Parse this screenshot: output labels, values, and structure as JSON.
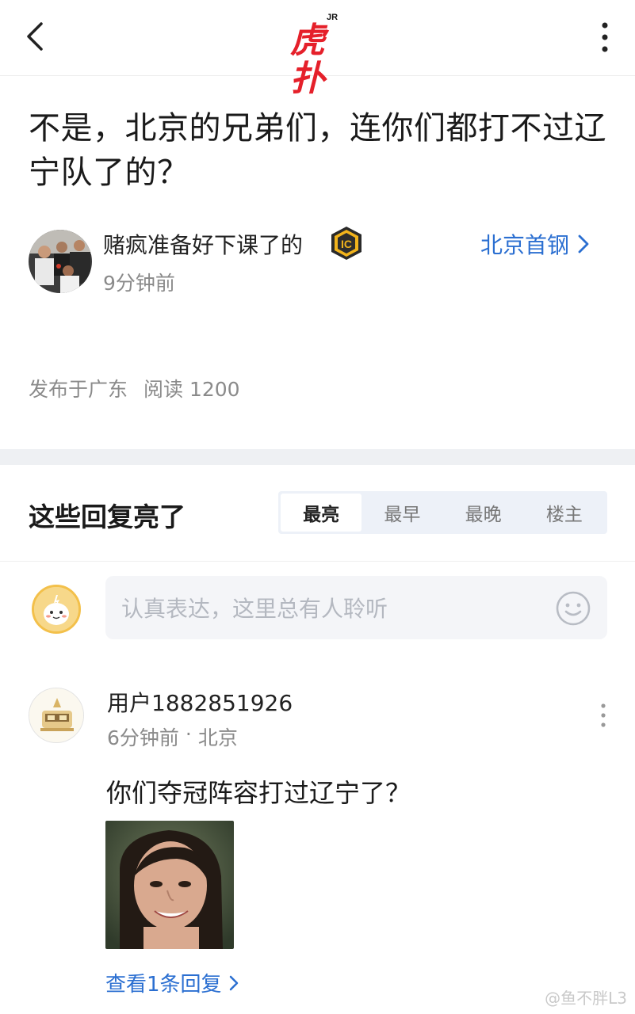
{
  "header": {
    "logo_small": "JR",
    "logo_text": "虎扑"
  },
  "post": {
    "title": "不是，北京的兄弟们，连你们都打不过辽宁队了的？",
    "author": "赌疯准备好下课了的",
    "time": "9分钟前",
    "team": "北京首钢",
    "location": "发布于广东",
    "reads": "阅读 1200"
  },
  "replies_section": {
    "title": "这些回复亮了",
    "tabs": [
      "最亮",
      "最早",
      "最晚",
      "楼主"
    ],
    "active_tab": "最亮"
  },
  "comment_box": {
    "placeholder": "认真表达，这里总有人聆听"
  },
  "reply": {
    "user": "用户1882851926",
    "time": "6分钟前",
    "separator": "·",
    "location": "北京",
    "text": "你们夺冠阵容打过辽宁了？",
    "view_replies": "查看1条回复"
  },
  "watermark": "@鱼不胖L3",
  "colors": {
    "brand_red": "#e5202a",
    "link_blue": "#2b6fd1"
  }
}
